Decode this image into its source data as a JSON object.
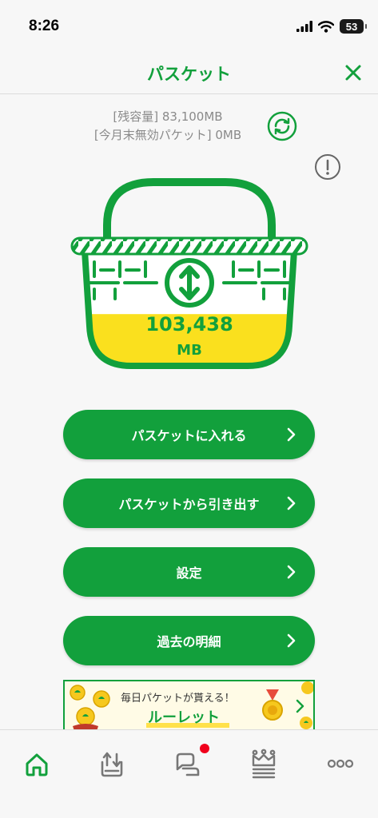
{
  "status_bar": {
    "time": "8:26",
    "battery": "53",
    "icons": [
      "cellular-signal-icon",
      "wifi-icon",
      "battery-icon"
    ]
  },
  "header": {
    "title": "パスケット",
    "close_icon": "close-icon"
  },
  "capacity": {
    "remaining": "[残容量] 83,100MB",
    "expiring": "[今月末無効パケット] 0MB"
  },
  "basket": {
    "value": "103,438",
    "unit": "MB",
    "fill_fraction": 0.45
  },
  "menu": [
    {
      "label": "パスケットに入れる"
    },
    {
      "label": "パスケットから引き出す"
    },
    {
      "label": "設定"
    },
    {
      "label": "過去の明細"
    }
  ],
  "banner": {
    "line1": "毎日パケットが貰える！",
    "line2": "ルーレット"
  },
  "tabs": [
    {
      "icon": "home-icon",
      "active": true
    },
    {
      "icon": "basket-upload-icon",
      "active": false
    },
    {
      "icon": "chat-icon",
      "active": false,
      "badge": true
    },
    {
      "icon": "crown-icon",
      "active": false
    },
    {
      "icon": "more-icon",
      "active": false
    }
  ],
  "colors": {
    "brand_green": "#12a03c",
    "basket_yellow": "#fae01e",
    "badge_red": "#f0001c",
    "gray_text": "#8a8a8a"
  }
}
